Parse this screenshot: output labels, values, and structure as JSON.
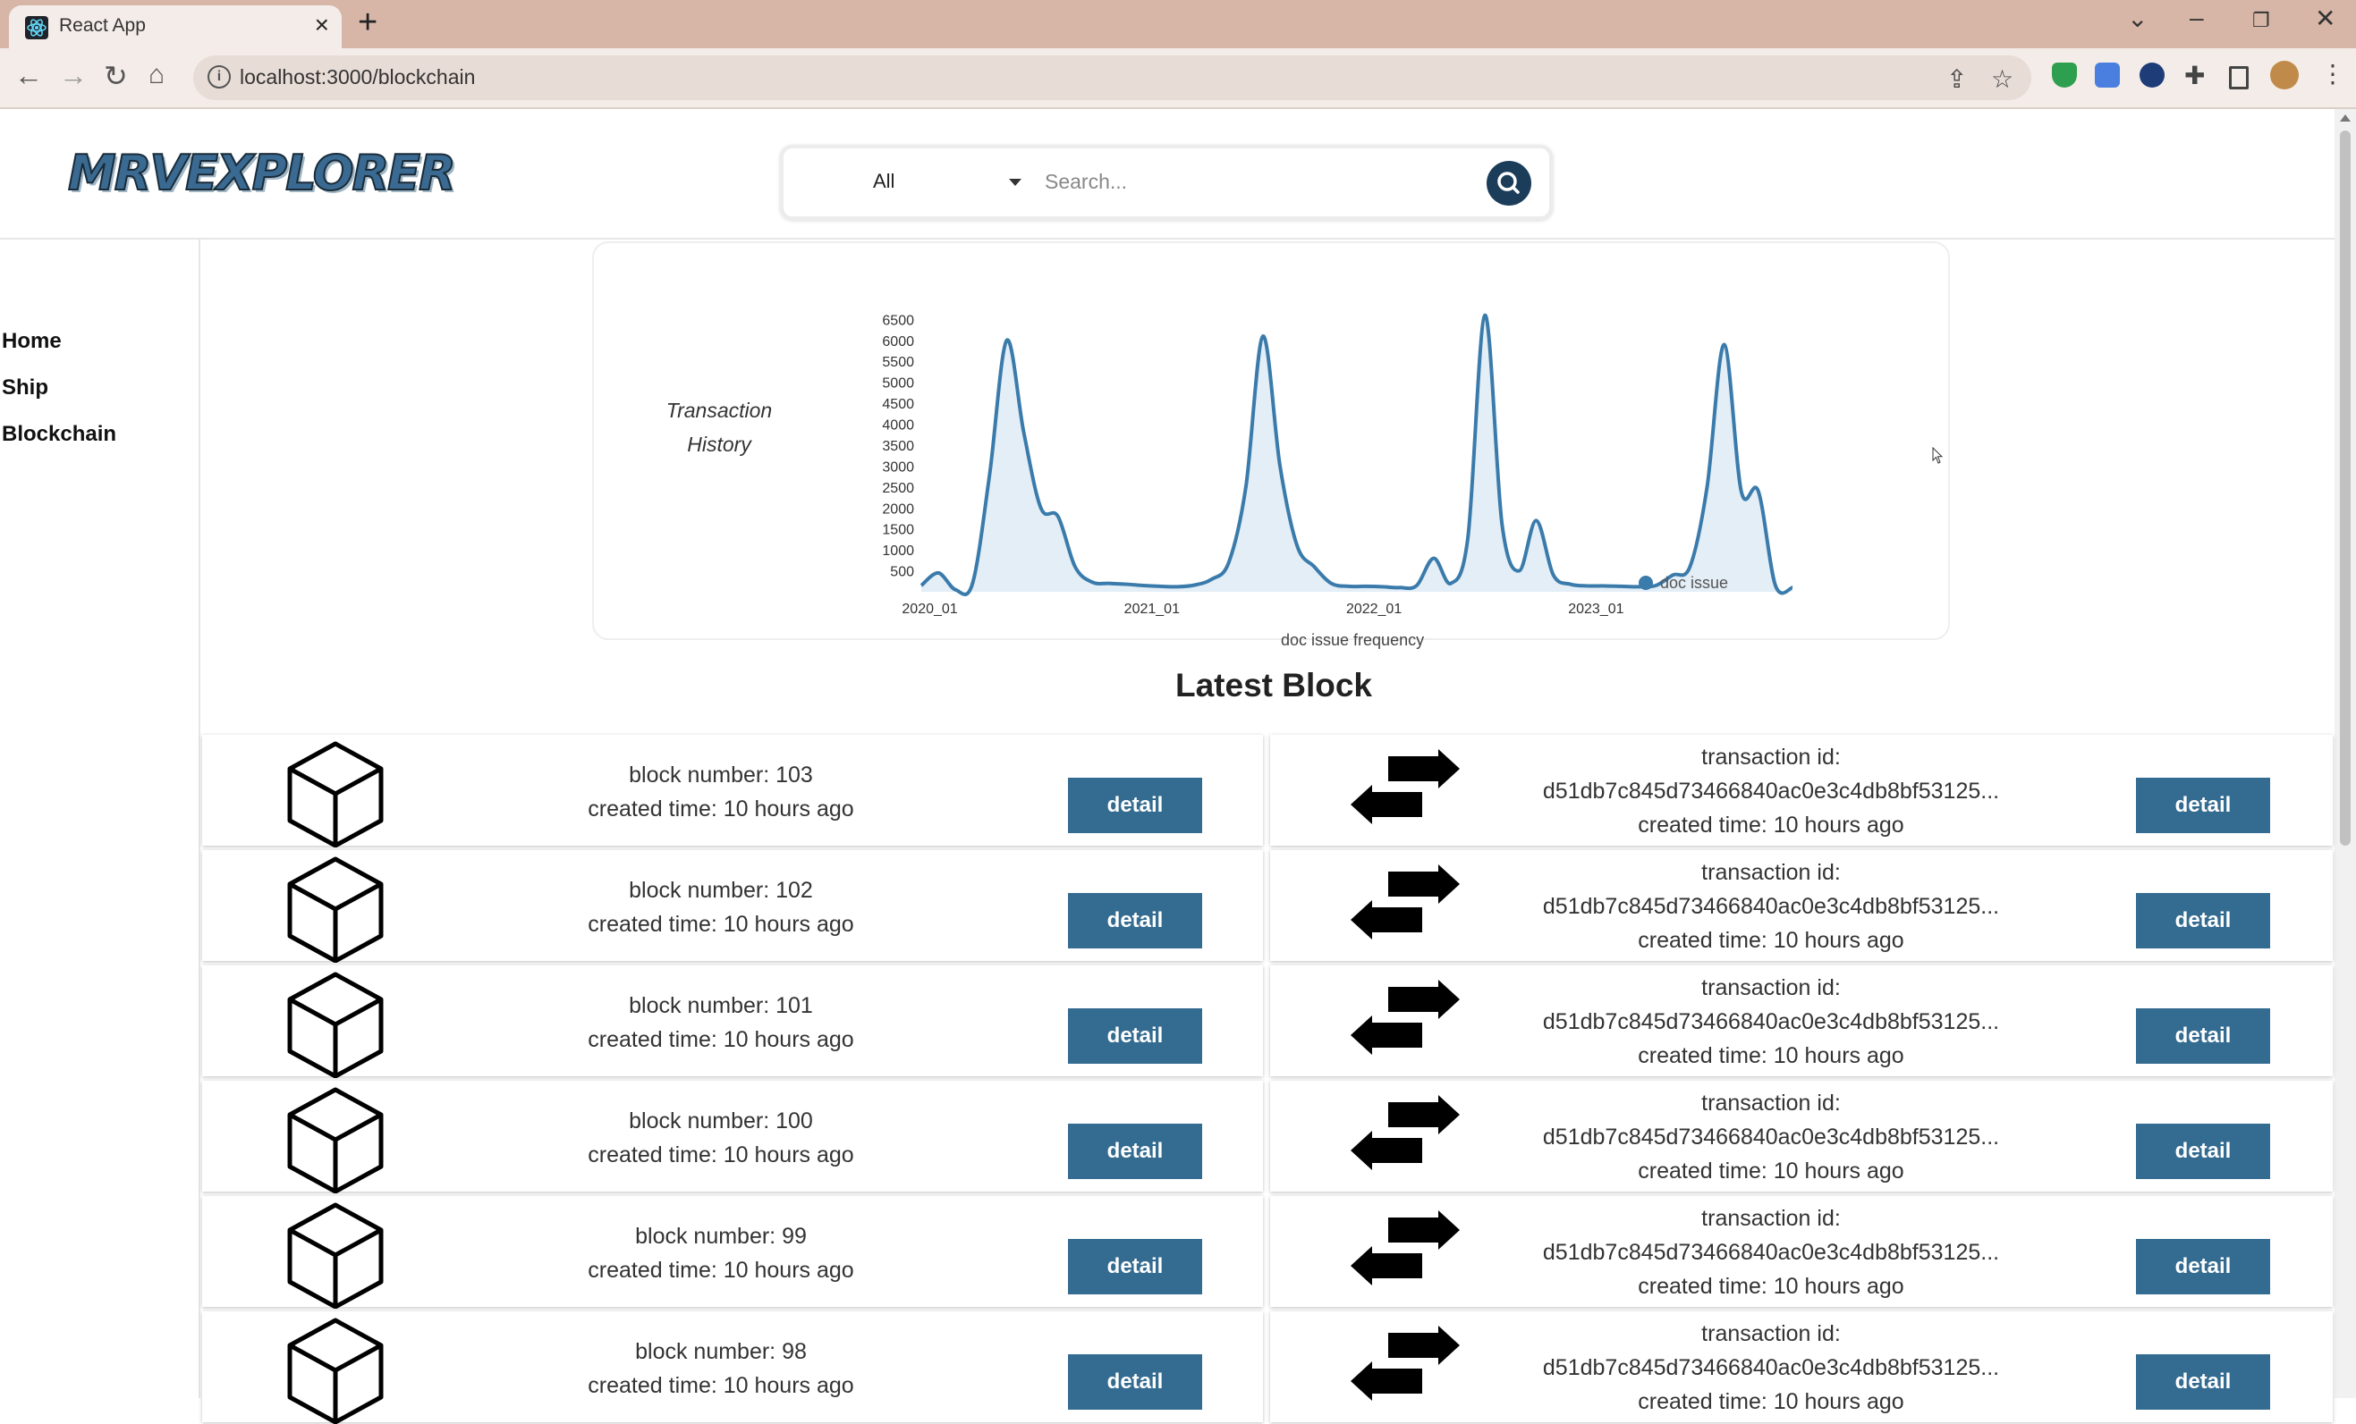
{
  "browser": {
    "tab_title": "React App",
    "url": "localhost:3000/blockchain"
  },
  "header": {
    "logo": "MRVEXPLORER",
    "search": {
      "category": "All",
      "placeholder": "Search..."
    }
  },
  "sidebar": {
    "items": [
      {
        "label": "Home"
      },
      {
        "label": "Ship"
      },
      {
        "label": "Blockchain"
      }
    ]
  },
  "chart": {
    "title": "Transaction History",
    "caption": "doc issue frequency"
  },
  "chart_data": {
    "type": "area",
    "title": "Transaction History",
    "xlabel": "doc issue frequency",
    "ylabel": "",
    "x_ticks": [
      "2020_01",
      "2021_01",
      "2022_01",
      "2023_01"
    ],
    "y_ticks": [
      500,
      1000,
      1500,
      2000,
      2500,
      3000,
      3500,
      4000,
      4500,
      5000,
      5500,
      6000,
      6500
    ],
    "ylim": [
      0,
      6700
    ],
    "legend_position": "bottom-right",
    "series": [
      {
        "name": "doc issue",
        "color": "#3a7bab",
        "points": [
          [
            0,
            150
          ],
          [
            1,
            450
          ],
          [
            2,
            50
          ],
          [
            3,
            200
          ],
          [
            4,
            2800
          ],
          [
            5,
            6000
          ],
          [
            6,
            3800
          ],
          [
            7,
            2000
          ],
          [
            8,
            1800
          ],
          [
            9,
            600
          ],
          [
            10,
            230
          ],
          [
            11,
            200
          ],
          [
            12,
            180
          ],
          [
            13,
            150
          ],
          [
            14,
            130
          ],
          [
            15,
            120
          ],
          [
            16,
            160
          ],
          [
            17,
            300
          ],
          [
            18,
            700
          ],
          [
            19,
            2500
          ],
          [
            20,
            6100
          ],
          [
            21,
            3000
          ],
          [
            22,
            1100
          ],
          [
            23,
            600
          ],
          [
            24,
            200
          ],
          [
            25,
            130
          ],
          [
            26,
            130
          ],
          [
            27,
            120
          ],
          [
            28,
            100
          ],
          [
            29,
            150
          ],
          [
            30,
            800
          ],
          [
            31,
            200
          ],
          [
            32,
            1300
          ],
          [
            33,
            6600
          ],
          [
            34,
            1600
          ],
          [
            35,
            500
          ],
          [
            36,
            1700
          ],
          [
            37,
            400
          ],
          [
            38,
            180
          ],
          [
            39,
            140
          ],
          [
            40,
            140
          ],
          [
            41,
            130
          ],
          [
            42,
            120
          ],
          [
            43,
            150
          ],
          [
            44,
            400
          ],
          [
            45,
            600
          ],
          [
            46,
            2500
          ],
          [
            47,
            5900
          ],
          [
            48,
            2400
          ],
          [
            49,
            2400
          ],
          [
            50,
            150
          ],
          [
            51,
            100
          ]
        ]
      }
    ]
  },
  "latest_block": {
    "title": "Latest Block",
    "rows": [
      {
        "block": "block number: 103",
        "block_time": "created time: 10 hours ago",
        "tx_label": "transaction id:",
        "tx_id": "d51db7c845d73466840ac0e3c4db8bf53125...",
        "tx_time": "created time: 10 hours ago",
        "detail": "detail"
      },
      {
        "block": "block number: 102",
        "block_time": "created time: 10 hours ago",
        "tx_label": "transaction id:",
        "tx_id": "d51db7c845d73466840ac0e3c4db8bf53125...",
        "tx_time": "created time: 10 hours ago",
        "detail": "detail"
      },
      {
        "block": "block number: 101",
        "block_time": "created time: 10 hours ago",
        "tx_label": "transaction id:",
        "tx_id": "d51db7c845d73466840ac0e3c4db8bf53125...",
        "tx_time": "created time: 10 hours ago",
        "detail": "detail"
      },
      {
        "block": "block number: 100",
        "block_time": "created time: 10 hours ago",
        "tx_label": "transaction id:",
        "tx_id": "d51db7c845d73466840ac0e3c4db8bf53125...",
        "tx_time": "created time: 10 hours ago",
        "detail": "detail"
      },
      {
        "block": "block number: 99",
        "block_time": "created time: 10 hours ago",
        "tx_label": "transaction id:",
        "tx_id": "d51db7c845d73466840ac0e3c4db8bf53125...",
        "tx_time": "created time: 10 hours ago",
        "detail": "detail"
      },
      {
        "block": "block number: 98",
        "block_time": "created time: 10 hours ago",
        "tx_label": "transaction id:",
        "tx_id": "d51db7c845d73466840ac0e3c4db8bf53125...",
        "tx_time": "created time: 10 hours ago",
        "detail": "detail"
      }
    ]
  },
  "colors": {
    "accent": "#336b91",
    "search_button": "#1b3d5a",
    "chart_line": "#3a7bab",
    "chart_fill": "#e3eef7"
  },
  "icons": [
    "react-logo-icon",
    "close-icon",
    "plus-icon",
    "back-icon",
    "forward-icon",
    "reload-icon",
    "home-icon",
    "info-icon",
    "share-icon",
    "star-icon",
    "search-icon",
    "cube-icon",
    "swap-arrows-icon"
  ]
}
